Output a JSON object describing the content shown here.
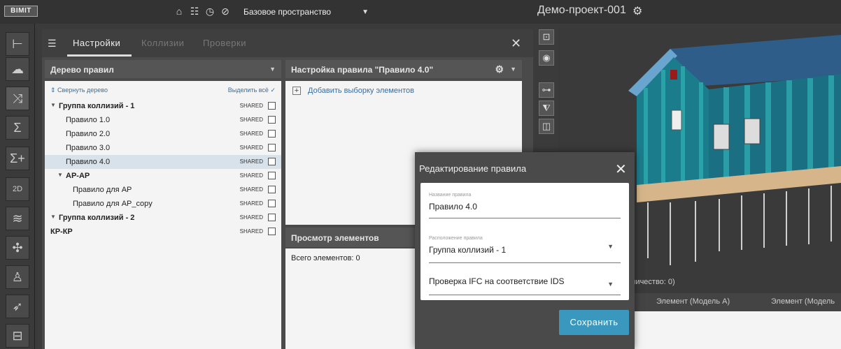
{
  "topbar": {
    "logo": "BIMIT",
    "space_label": "Базовое пространство",
    "project_title": "Демо-проект-001"
  },
  "tabs": {
    "settings": "Настройки",
    "collisions": "Коллизии",
    "checks": "Проверки"
  },
  "tree": {
    "header": "Дерево правил",
    "collapse": "Свернуть дерево",
    "select_all": "Выделить всё",
    "shared_label": "SHARED",
    "items": [
      {
        "label": "Группа коллизий - 1",
        "level": 0,
        "bold": true,
        "caret": true
      },
      {
        "label": "Правило 1.0",
        "level": 1
      },
      {
        "label": "Правило 2.0",
        "level": 1
      },
      {
        "label": "Правило 3.0",
        "level": 1
      },
      {
        "label": "Правило 4.0",
        "level": 1,
        "selected": true
      },
      {
        "label": "АР-АР",
        "level": 1,
        "bold": true,
        "caret": true
      },
      {
        "label": "Правило для АР",
        "level": 2
      },
      {
        "label": "Правило для АР_copy",
        "level": 2
      },
      {
        "label": "Группа коллизий - 2",
        "level": 0,
        "bold": true,
        "caret": true
      },
      {
        "label": "КР-КР",
        "level": 0,
        "bold": true
      }
    ]
  },
  "rule_settings": {
    "header": "Настройка правила \"Правило 4.0\"",
    "add_selection": "Добавить выборку элементов"
  },
  "elements": {
    "header": "Просмотр элементов",
    "total": "Всего элементов: 0"
  },
  "results": {
    "count": "личество: 0)",
    "col_a": "Элемент (Модель А)",
    "col_b": "Элемент (Модель"
  },
  "modal": {
    "title": "Редактирование правила",
    "name_label": "Название правила",
    "name_value": "Правило 4.0",
    "location_label": "Расположение правила",
    "location_value": "Группа коллизий - 1",
    "check_value": "Проверка IFC на соответствие IDS",
    "save": "Сохранить"
  },
  "colors": {
    "accent": "#3a98bf",
    "panel": "#4a4a4a",
    "selected_row": "#d8e2ea"
  }
}
